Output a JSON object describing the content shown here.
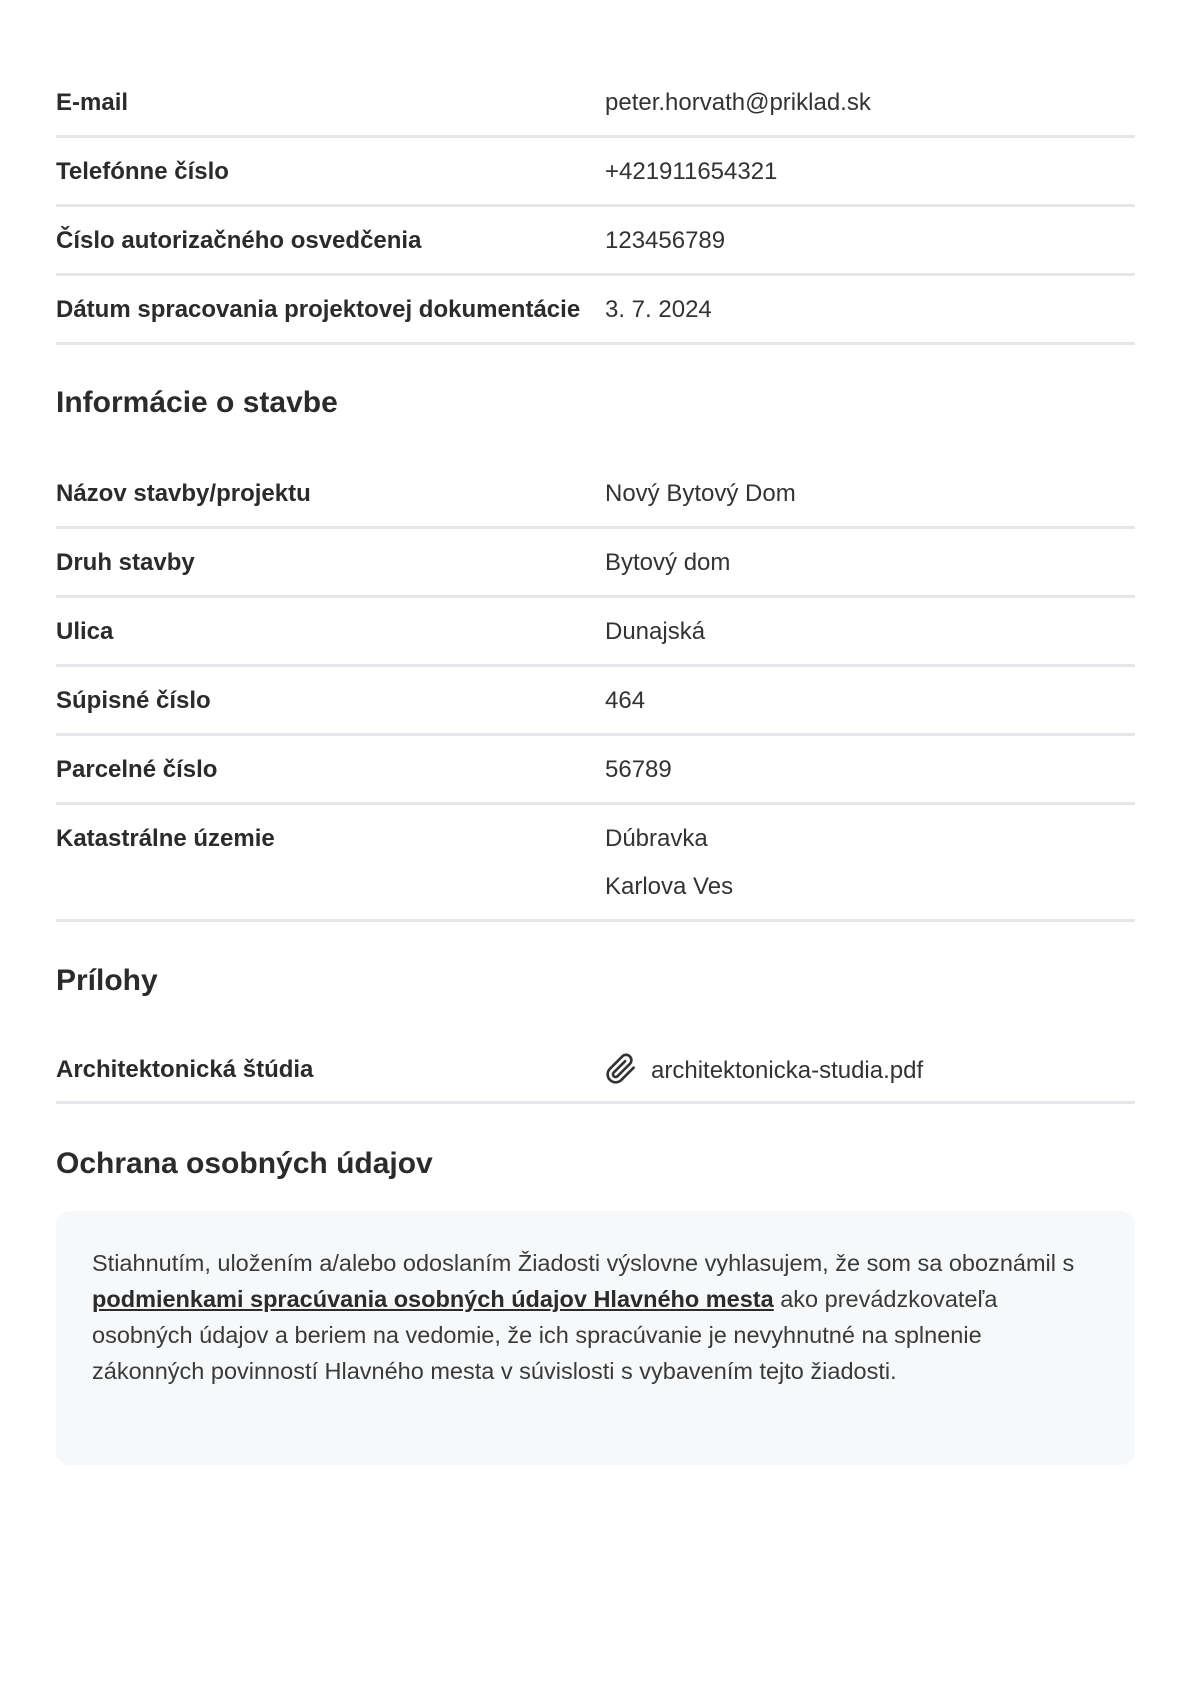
{
  "contact_rows": [
    {
      "label": "E-mail",
      "value": "peter.horvath@priklad.sk"
    },
    {
      "label": "Telefónne číslo",
      "value": "+421911654321"
    },
    {
      "label": "Číslo autorizačného osvedčenia",
      "value": "123456789"
    },
    {
      "label": "Dátum spracovania projektovej dokumentácie",
      "value": "3. 7. 2024"
    }
  ],
  "building_section": {
    "title": "Informácie o stavbe",
    "rows": [
      {
        "label": "Názov stavby/projektu",
        "value": "Nový Bytový Dom"
      },
      {
        "label": "Druh stavby",
        "value": "Bytový dom"
      },
      {
        "label": "Ulica",
        "value": "Dunajská"
      },
      {
        "label": "Súpisné číslo",
        "value": "464"
      },
      {
        "label": "Parcelné číslo",
        "value": "56789"
      }
    ],
    "cadastral": {
      "label": "Katastrálne územie",
      "values": [
        "Dúbravka",
        "Karlova Ves"
      ]
    }
  },
  "attachments_section": {
    "title": "Prílohy",
    "rows": [
      {
        "label": "Architektonická štúdia",
        "file": "architektonicka-studia.pdf",
        "icon": "paperclip-icon"
      }
    ]
  },
  "privacy_section": {
    "title": "Ochrana osobných údajov",
    "text_before": "Stiahnutím, uložením a/alebo odoslaním Žiadosti výslovne vyhlasujem, že som sa oboznámil s ",
    "link_text": "podmienkami spracúvania osobných údajov Hlavného mesta",
    "text_after": " ako prevádzkovateľa osobných údajov a beriem na vedomie, že ich spracúvanie je nevyhnutné na splnenie zákonných povinností Hlavného mesta v súvislosti s vybavením tejto žiadosti."
  }
}
